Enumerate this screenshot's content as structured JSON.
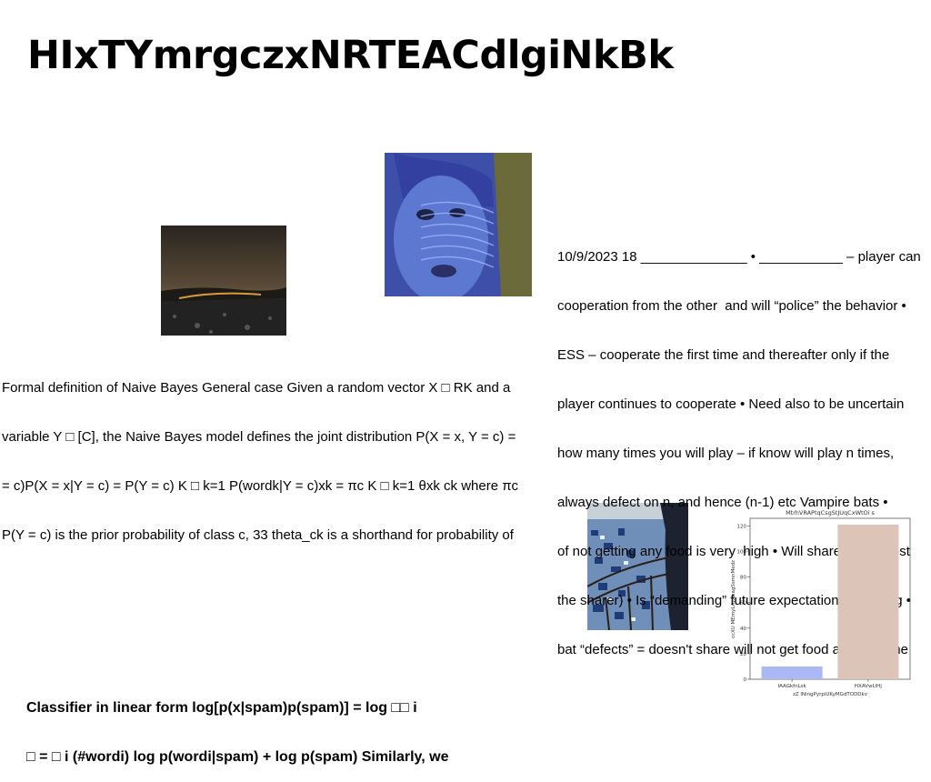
{
  "page_title": "HIxTYmrgczxNRTEACdlgiNkBk",
  "text_blocks": {
    "naive_bayes": [
      "Formal definition of Naive Bayes General case Given a random vector X □ RK and a",
      "variable Y □ [C], the Naive Bayes model defines the joint distribution P(X = x, Y = c) =",
      "= c)P(X = x|Y = c) = P(Y = c) K □ k=1 P(wordk|Y = c)xk = πc K □ k=1 θxk ck where πc",
      "P(Y = c) is the prior probability of class c, 33 theta_ck is a shorthand for probability of"
    ],
    "game_theory": [
      "10/9/2023 18 ______________ • ___________ – player can",
      "cooperation from the other  and will “police” the behavior •",
      "ESS – cooperate the first time and thereafter only if the",
      "player continues to cooperate • Need also to be uncertain",
      "how many times you will play – if know will play n times,",
      "always defect on n, and hence (n-1) etc Vampire bats •",
      "of not getting any food is very  high • Will share (small cost",
      "the sharer) • Is “demanding” future expectation of sharing •",
      "bat “defects” = doesn't share will not get food another time"
    ],
    "classifier": [
      "Classifier in linear form log[p(x|spam)p(spam)] = log □□ i",
      "□ = □ i (#wordi) log p(wordi|spam) + log p(spam) Similarly, we"
    ]
  },
  "chart_data": {
    "type": "bar",
    "title": "MtrhVRAPtqCsgStJUqCxWtOi s",
    "xlabel": "zZ lNingPyrpiUKyMGdTODDkv",
    "ylabel": "ccXU MEmyLAyAhagSsmnMedz",
    "categories": [
      "IAAGkfnLsk",
      "HXAVwLIHj"
    ],
    "values": [
      10,
      121
    ],
    "colors": [
      "#aab8f4",
      "#dcc5b8"
    ],
    "ylim": [
      0,
      126
    ],
    "yticks": [
      0,
      20,
      40,
      60,
      80,
      100,
      120
    ],
    "grid": false
  }
}
